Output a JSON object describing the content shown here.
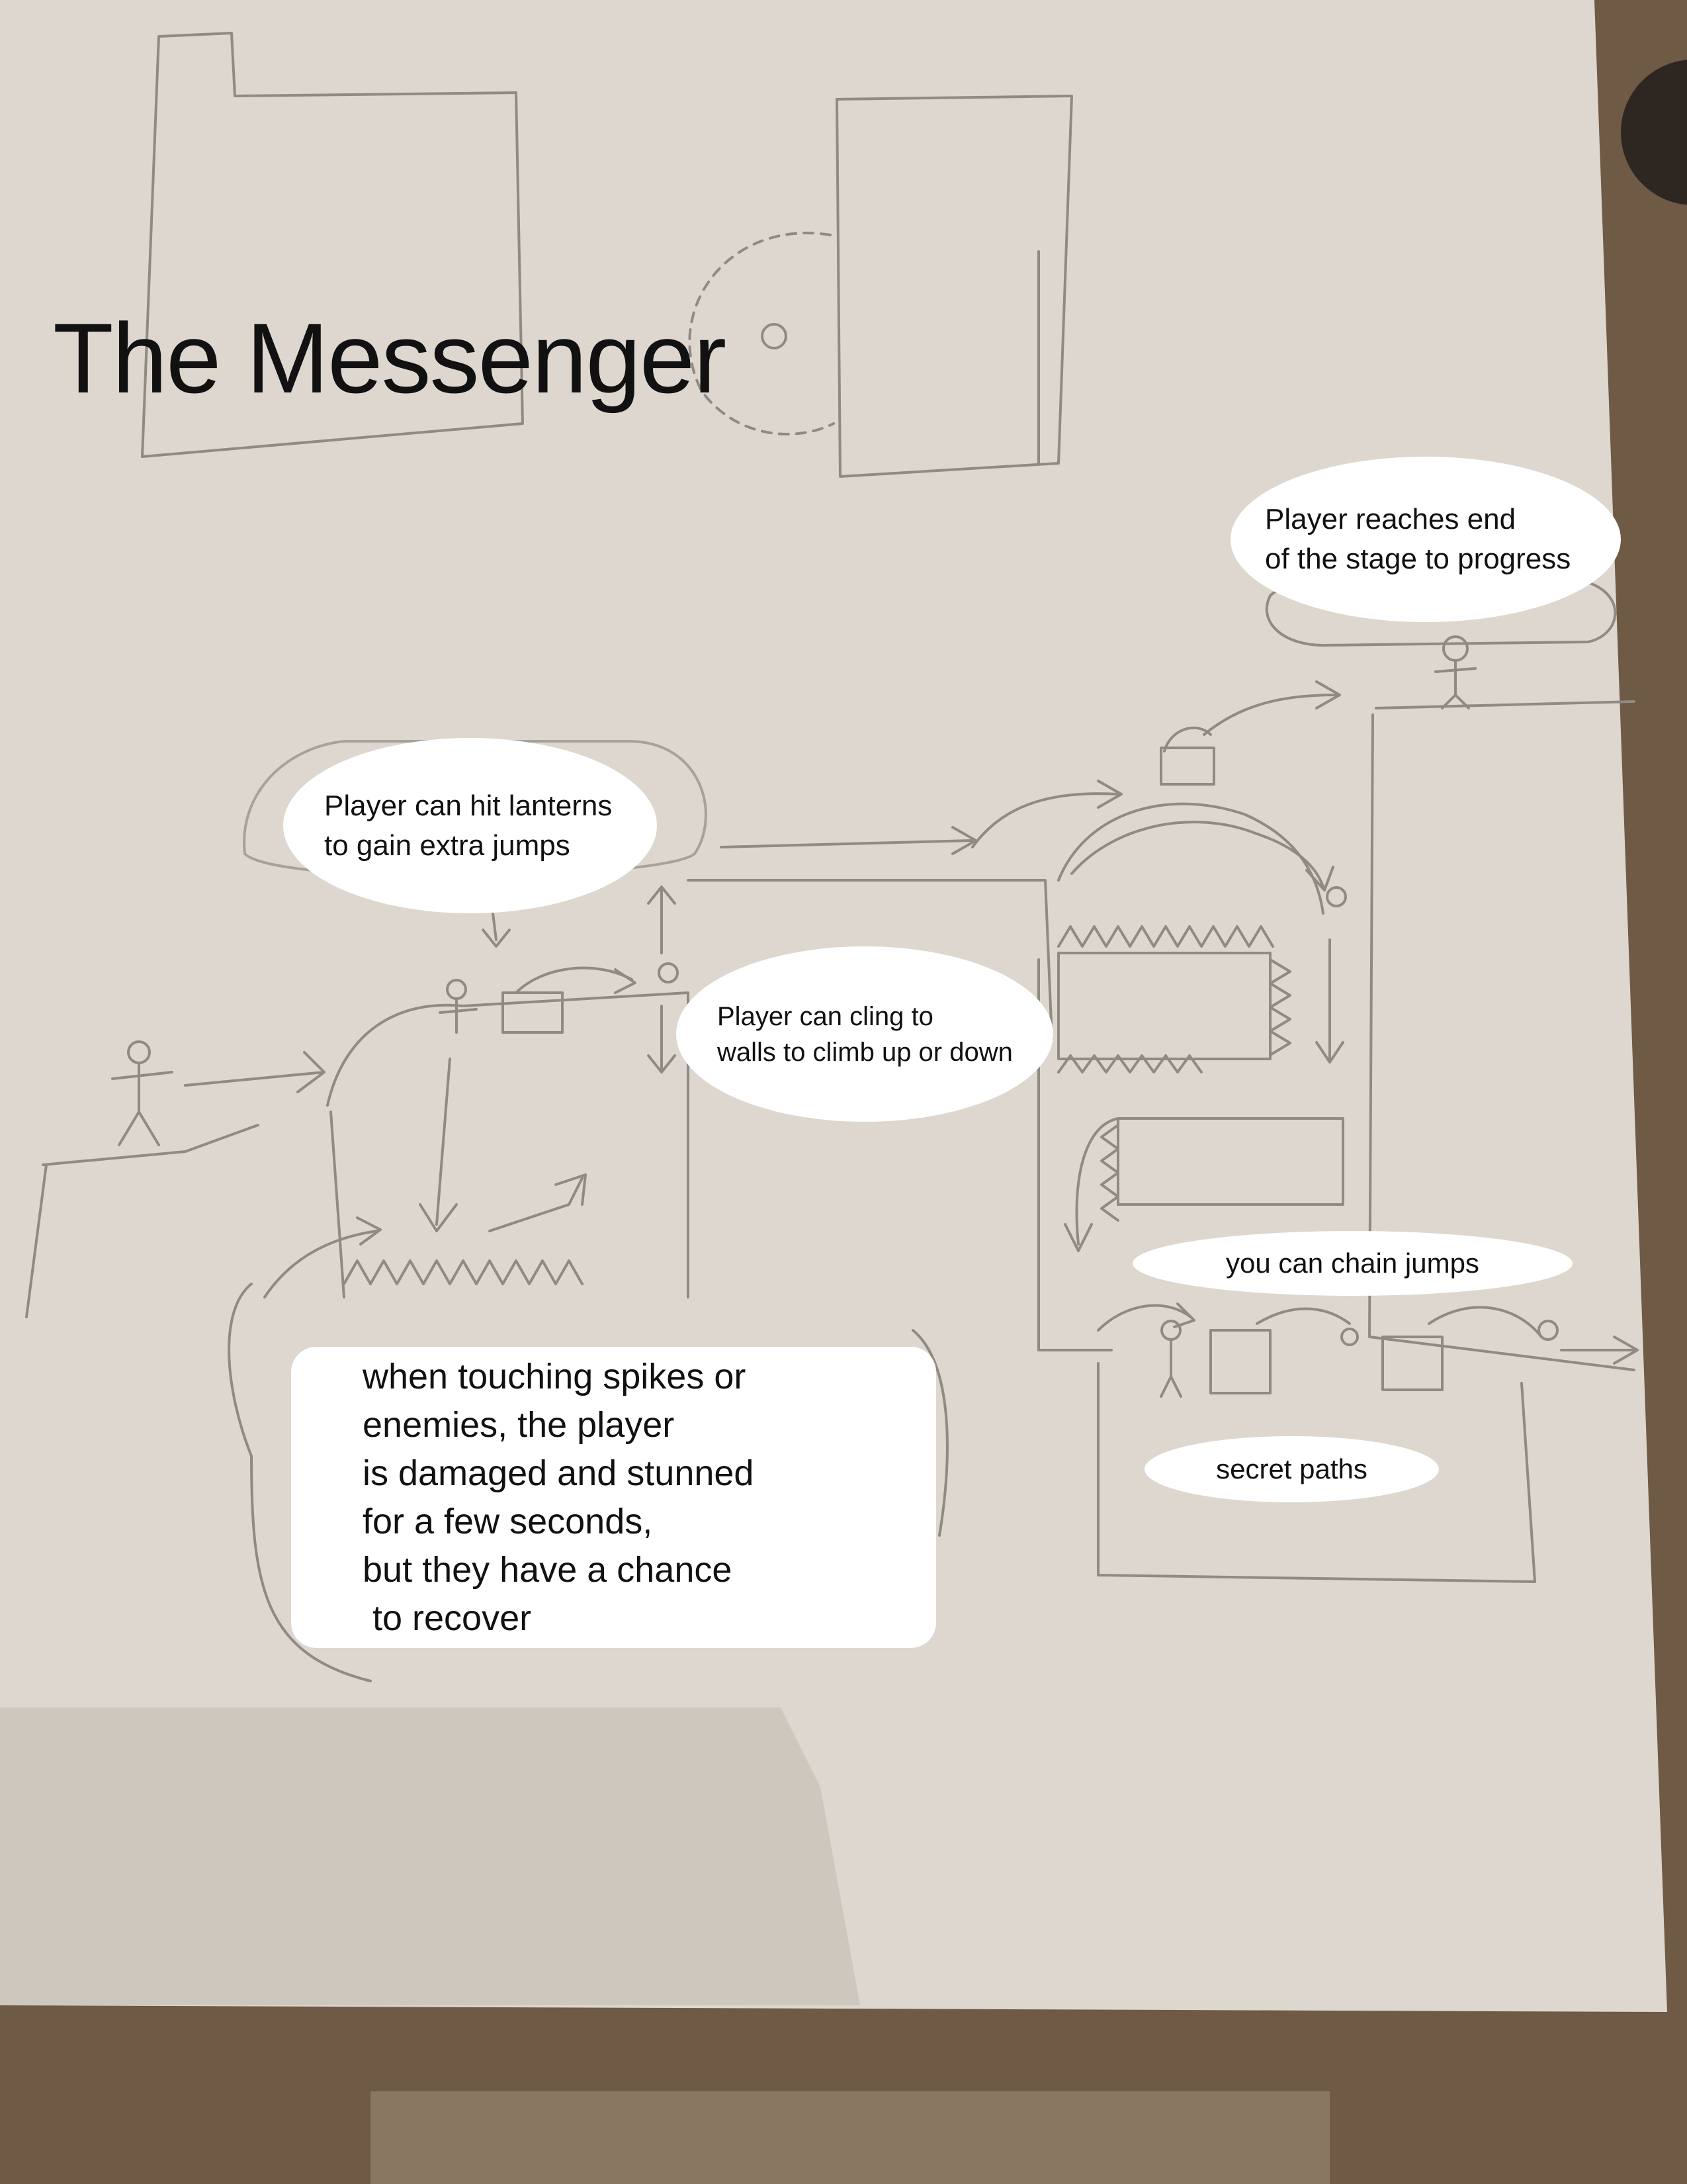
{
  "title": "The Messenger",
  "callouts": {
    "stage_end": [
      "Player reaches end",
      "of the stage to progress"
    ],
    "lanterns": [
      "Player can hit lanterns",
      "to gain extra jumps"
    ],
    "cling": [
      "Player can cling to",
      "walls to climb up or down"
    ],
    "chain_jumps": "you can chain jumps",
    "secret_paths": "secret paths",
    "spikes": [
      "when touching spikes or",
      "enemies, the player",
      "is damaged and stunned",
      "for a few seconds,",
      "but they have a chance",
      " to recover"
    ]
  },
  "colors": {
    "paper": "#ddd7cf",
    "pencil": "#8f8a84",
    "floor": "#6e5a45",
    "bubble": "#ffffff",
    "text": "#111111"
  }
}
